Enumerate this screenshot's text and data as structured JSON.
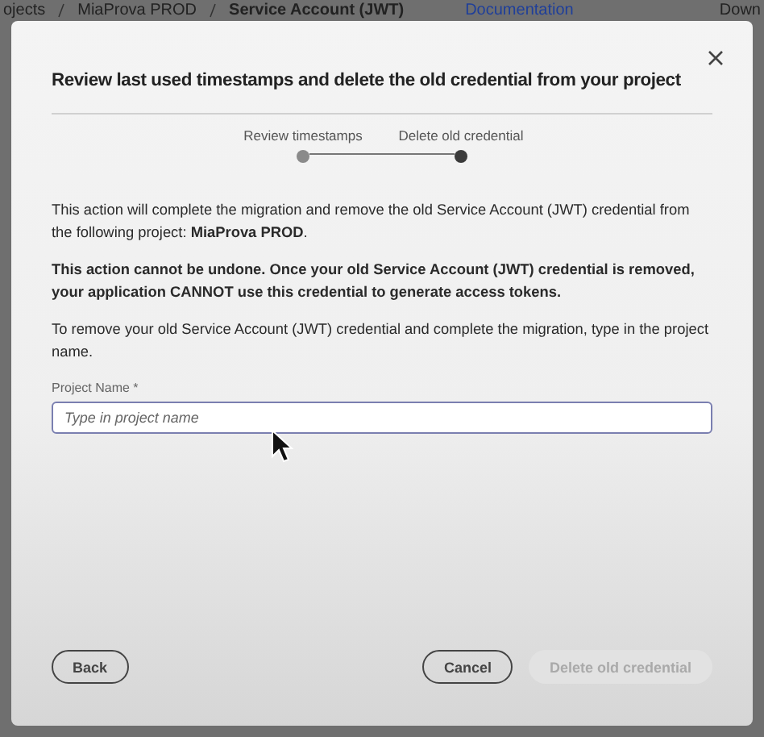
{
  "background": {
    "breadcrumb": [
      "ojects",
      "MiaProva PROD",
      "Service Account (JWT)"
    ],
    "link": "Documentation",
    "action": "Down"
  },
  "dialog": {
    "title": "Review last used timestamps and delete the old credential from your project",
    "steps": [
      {
        "label": "Review timestamps",
        "selected": false
      },
      {
        "label": "Delete old credential",
        "selected": true
      }
    ],
    "paragraphs": [
      {
        "text": "This action will complete the migration and remove the old Service Account (JWT) credential from the following project: **MiaProva PROD**.",
        "bold": false
      },
      {
        "text": "This action cannot be undone. Once your old Service Account (JWT) credential is removed, your application CANNOT use this credential to generate access tokens.",
        "bold": true
      },
      {
        "text": "To remove your old Service Account (JWT) credential and complete the migration, type in the project name.",
        "bold": false
      }
    ],
    "field": {
      "label": "Project Name *",
      "placeholder": "Type in project name"
    },
    "buttons": [
      {
        "label": "Back",
        "disabled": false
      },
      {
        "label": "Cancel",
        "disabled": false
      },
      {
        "label": "Delete old credential",
        "disabled": true
      }
    ]
  }
}
